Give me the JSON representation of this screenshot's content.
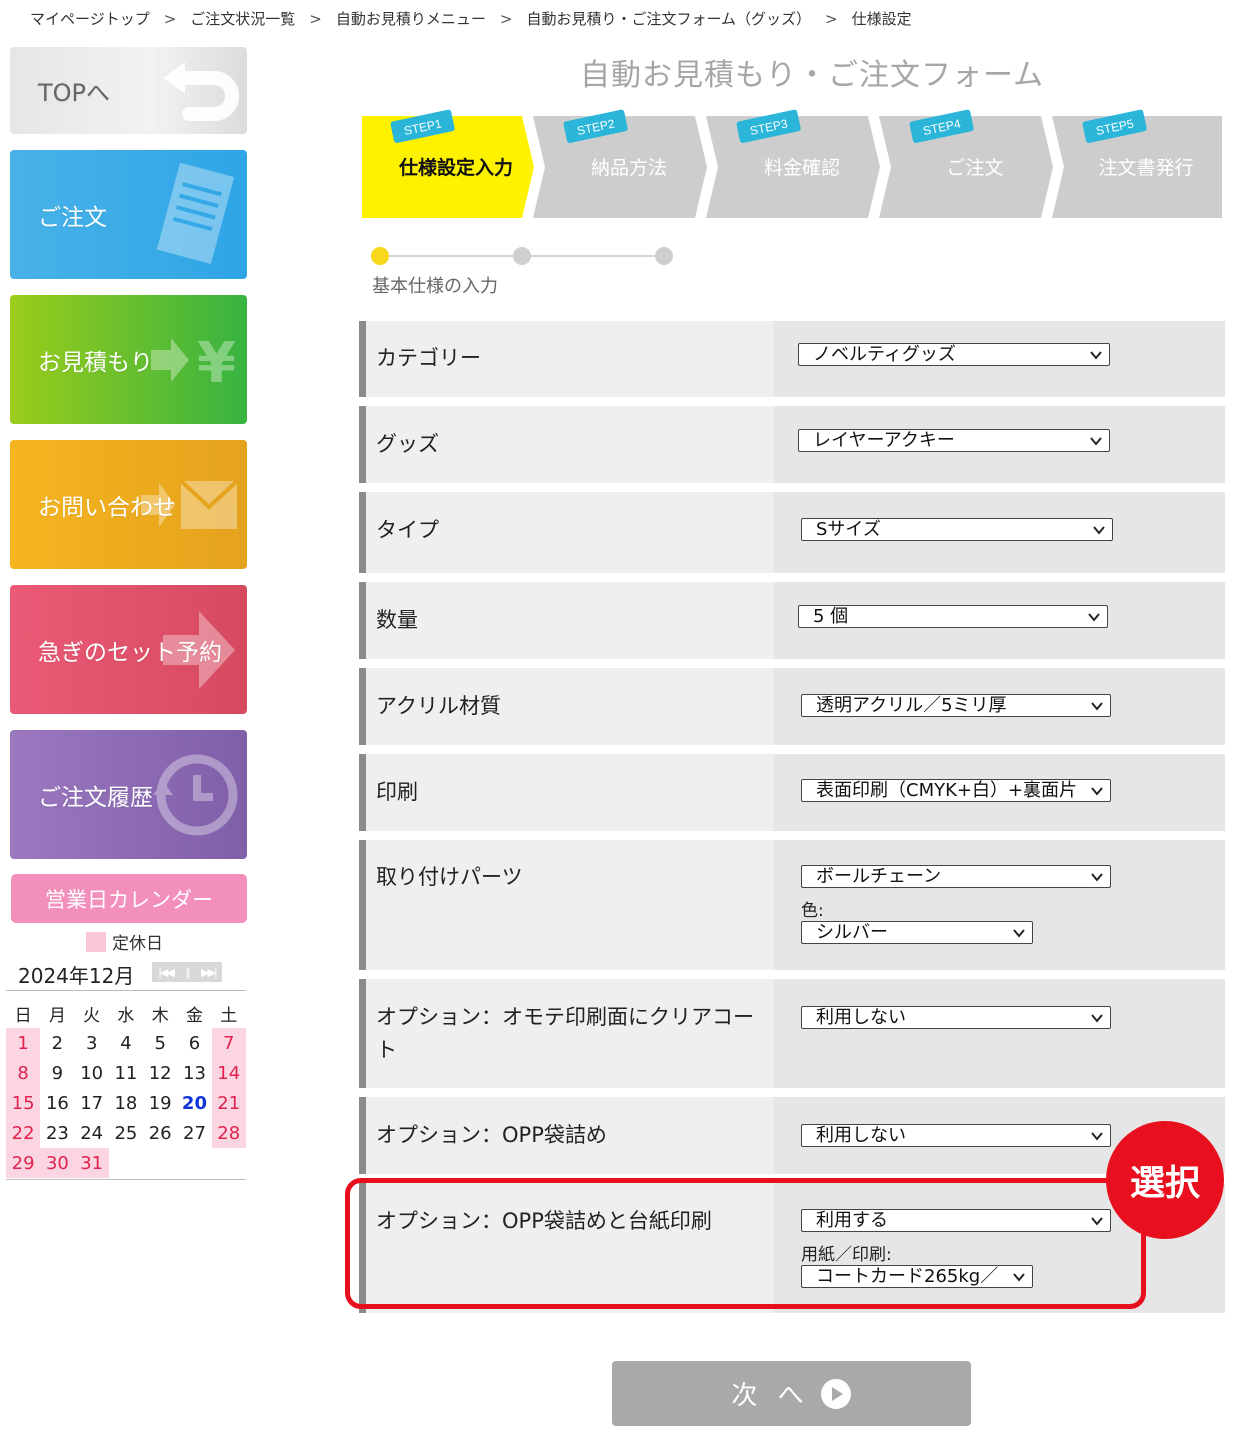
{
  "breadcrumb": [
    "マイページトップ",
    "ご注文状況一覧",
    "自動お見積りメニュー",
    "自動お見積り・ご注文フォーム（グッズ）",
    "仕様設定"
  ],
  "breadcrumb_sep": ">",
  "sidebar": {
    "top": "TOPへ",
    "order": "ご注文",
    "quote": "お見積もり",
    "contact": "お問い合わせ",
    "rush": "急ぎのセット予約",
    "history": "ご注文履歴"
  },
  "calendar": {
    "title": "営業日カレンダー",
    "legend": "定休日",
    "month": "2024年12月",
    "weekdays": [
      "日",
      "月",
      "火",
      "水",
      "木",
      "金",
      "土"
    ],
    "holidays": [
      1,
      7,
      8,
      14,
      15,
      21,
      22,
      28,
      29,
      30,
      31
    ],
    "today": 20,
    "days": 31
  },
  "form_title": "自動お見積もり・ご注文フォーム",
  "steps": [
    {
      "tag": "STEP1",
      "label": "仕様設定入力",
      "active": true
    },
    {
      "tag": "STEP2",
      "label": "納品方法",
      "active": false
    },
    {
      "tag": "STEP3",
      "label": "料金確認",
      "active": false
    },
    {
      "tag": "STEP4",
      "label": "ご注文",
      "active": false
    },
    {
      "tag": "STEP5",
      "label": "注文書発行",
      "active": false
    }
  ],
  "progress_caption": "基本仕様の入力",
  "fields": {
    "category": {
      "label": "カテゴリー",
      "value": "ノベルティグッズ"
    },
    "goods": {
      "label": "グッズ",
      "value": "レイヤーアクキー"
    },
    "type": {
      "label": "タイプ",
      "value": "Sサイズ"
    },
    "quantity": {
      "label": "数量",
      "value": "5 個"
    },
    "material": {
      "label": "アクリル材質",
      "value": "透明アクリル／5ミリ厚"
    },
    "print": {
      "label": "印刷",
      "value": "表面印刷（CMYK+白）+裏面片"
    },
    "parts": {
      "label": "取り付けパーツ",
      "value": "ボールチェーン",
      "sub_label": "色:",
      "sub_value": "シルバー"
    },
    "clear_coat": {
      "label": "オプション：オモテ印刷面にクリアコート",
      "value": "利用しない"
    },
    "opp": {
      "label": "オプション：OPP袋詰め",
      "value": "利用しない"
    },
    "opp_card": {
      "label": "オプション：OPP袋詰めと台紙印刷",
      "value": "利用する",
      "sub_label": "用紙／印刷:",
      "sub_value": "コートカード265kg／"
    }
  },
  "badge": "選択",
  "next_button": "次 へ",
  "colors": {
    "accent_step": "#fff200",
    "step_tag": "#2bb6d9",
    "highlight": "#e8101e",
    "progress_dot": "#f7d81c"
  }
}
